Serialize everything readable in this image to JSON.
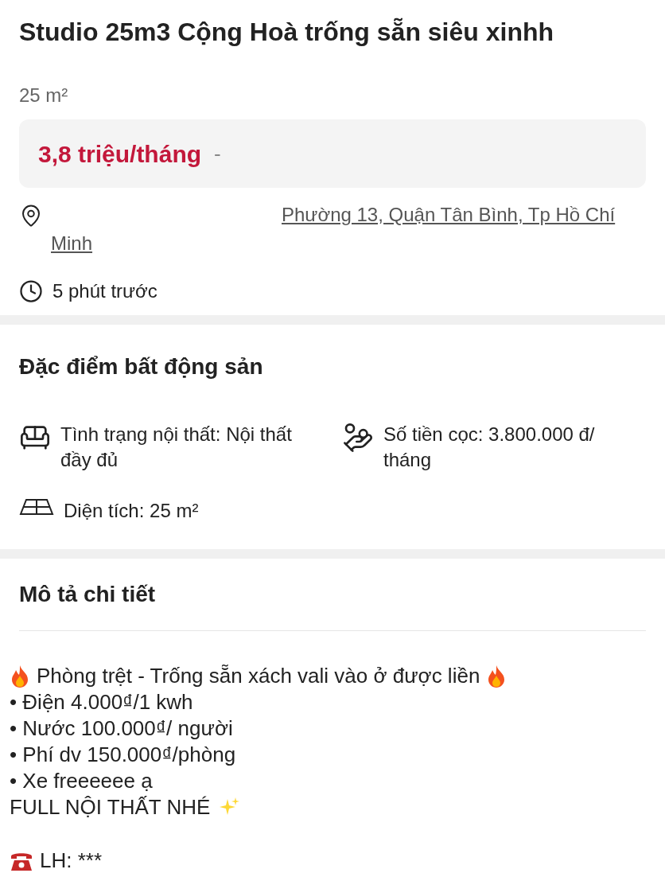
{
  "title": "Studio 25m3 Cộng Hoà trống sẵn siêu xinhh",
  "area": "25 m²",
  "price": {
    "value": "3,8 triệu/tháng",
    "suffix": "-"
  },
  "address": "Phường 13, Quận Tân Bình, Tp Hồ Chí Minh",
  "posted": "5 phút trước",
  "features": {
    "title": "Đặc điểm bất động sản",
    "items": [
      {
        "kind": "furniture",
        "text": "Tình trạng nội thất: Nội thất đầy đủ"
      },
      {
        "kind": "deposit",
        "text": "Số tiền cọc: 3.800.000 đ/ tháng"
      },
      {
        "kind": "area",
        "text": "Diện tích: 25 m²"
      }
    ]
  },
  "description": {
    "title": "Mô tả chi tiết",
    "lines": [
      {
        "kind": "fire",
        "text": "Phòng trệt - Trống sẵn xách vali vào ở được liền"
      },
      {
        "kind": "plain",
        "text": "• Điện 4.000₫/1 kwh"
      },
      {
        "kind": "plain",
        "text": "• Nước 100.000₫/ người"
      },
      {
        "kind": "plain",
        "text": "• Phí dv 150.000₫/phòng"
      },
      {
        "kind": "plain",
        "text": "• Xe freeeeee ạ"
      },
      {
        "kind": "sparkle",
        "text": "FULL NỘI THẤT NHÉ"
      },
      {
        "kind": "gap"
      },
      {
        "kind": "phone",
        "text": "LH: ***"
      }
    ]
  }
}
